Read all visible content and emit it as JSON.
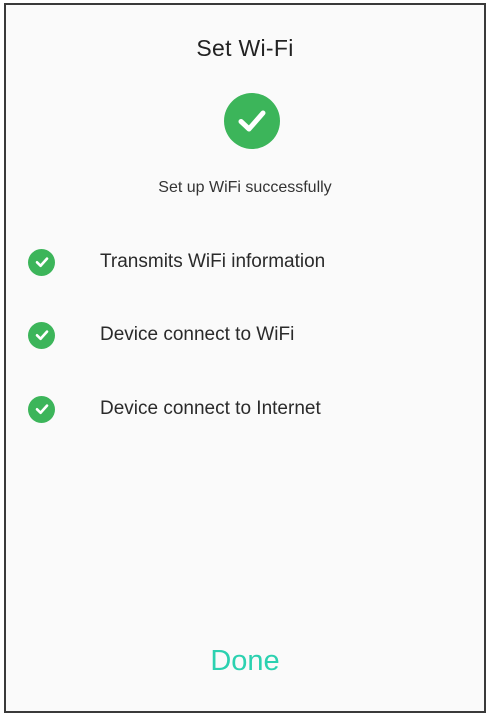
{
  "header": {
    "title": "Set Wi-Fi"
  },
  "status": {
    "icon": "check-circle-icon",
    "message": "Set up WiFi successfully"
  },
  "steps": [
    {
      "label": "Transmits WiFi information",
      "icon": "check-circle-icon",
      "done": true
    },
    {
      "label": "Device connect to WiFi",
      "icon": "check-circle-icon",
      "done": true
    },
    {
      "label": "Device connect to Internet",
      "icon": "check-circle-icon",
      "done": true
    }
  ],
  "footer": {
    "done_label": "Done"
  },
  "colors": {
    "success": "#3cb55a",
    "accent": "#2bd1b0",
    "text": "#2a2a2a"
  }
}
